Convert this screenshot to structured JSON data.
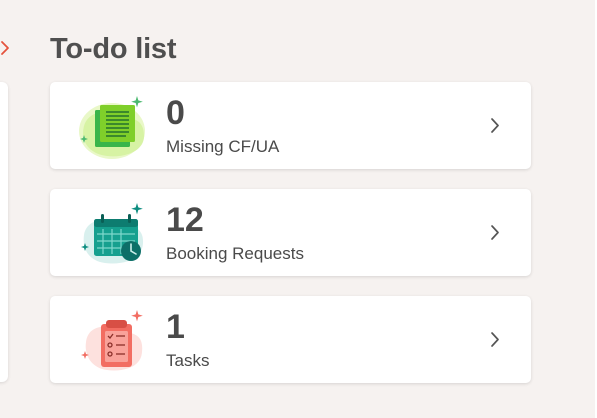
{
  "todo": {
    "title": "To-do list",
    "items": [
      {
        "count": "0",
        "label": "Missing CF/UA",
        "icon": "document-icon"
      },
      {
        "count": "12",
        "label": "Booking Requests",
        "icon": "calendar-clock-icon"
      },
      {
        "count": "1",
        "label": "Tasks",
        "icon": "clipboard-checklist-icon"
      }
    ]
  },
  "colors": {
    "background": "#f6f2f0",
    "text": "#4a4a4a",
    "missing_accent": "#39b54a",
    "booking_accent": "#0f9a8c",
    "tasks_accent": "#f16b63",
    "left_chevron": "#e5533d"
  }
}
